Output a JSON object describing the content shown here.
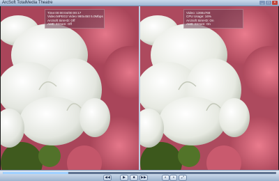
{
  "window": {
    "title": "ArcSoft TotalMedia Theatre",
    "controls": {
      "minimize": "_",
      "maximize": "□",
      "close": "×"
    }
  },
  "left_overlay": {
    "lines": [
      "Time:00:00:04/00:00:17",
      "Video:MPEG2 Video 980x450 5.0Mbps",
      "ArcSoft SimHD: Off",
      "AMD Stream: Off"
    ]
  },
  "right_overlay": {
    "lines": [
      "Video: 1366x768",
      "CPU Usage: 16%",
      "ArcSoft SimHD: On",
      "AMD Stream: On"
    ]
  },
  "playback": {
    "progress": 0.24,
    "buttons": {
      "prev": "◀◀",
      "play": "▶",
      "stop": "■",
      "next": "▶▶",
      "a": "◐",
      "b": "◑",
      "full": "⤢"
    }
  },
  "colors": {
    "petal_white": "#eef0ea",
    "rose": "#c25a6a",
    "leaf": "#3f5a1e",
    "frame": "#9fb6d3"
  }
}
